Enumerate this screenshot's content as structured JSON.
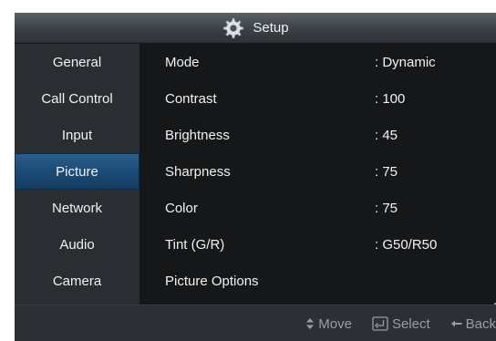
{
  "title": {
    "text": "Setup",
    "icon": "gear-icon"
  },
  "sidebar": {
    "items": [
      {
        "label": "General"
      },
      {
        "label": "Call Control"
      },
      {
        "label": "Input"
      },
      {
        "label": "Picture"
      },
      {
        "label": "Network"
      },
      {
        "label": "Audio"
      },
      {
        "label": "Camera"
      }
    ],
    "selected": "Picture"
  },
  "settings": [
    {
      "label": "Mode",
      "value": ": Dynamic"
    },
    {
      "label": "Contrast",
      "value": ": 100"
    },
    {
      "label": "Brightness",
      "value": ": 45"
    },
    {
      "label": "Sharpness",
      "value": ": 75"
    },
    {
      "label": "Color",
      "value": ": 75"
    },
    {
      "label": "Tint (G/R)",
      "value": ": G50/R50"
    },
    {
      "label": "Picture Options",
      "value": ""
    }
  ],
  "footer": {
    "move_label": "Move",
    "select_label": "Select",
    "back_label": "Back"
  },
  "colors": {
    "selected_item": "#1c4b76",
    "panel_bg": "#151719",
    "sidebar_bg": "#2a2d31"
  }
}
